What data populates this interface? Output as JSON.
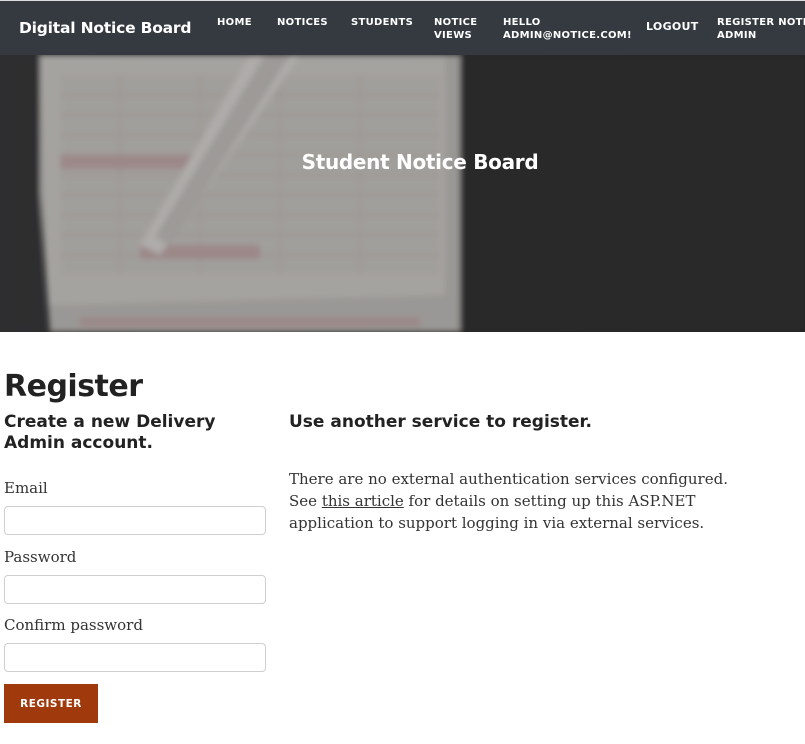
{
  "nav": {
    "brand": "Digital Notice Board",
    "links": [
      {
        "lines": [
          "HOME"
        ]
      },
      {
        "lines": [
          "NOTICES"
        ]
      },
      {
        "lines": [
          "STUDENTS"
        ]
      },
      {
        "lines": [
          "NOTICE",
          "VIEWS"
        ]
      },
      {
        "lines": [
          "HELLO",
          "ADMIN@NOTICE.COM!"
        ]
      },
      {
        "lines": [
          "LOGOUT"
        ]
      },
      {
        "lines": [
          "REGISTER NOTICE",
          "ADMIN"
        ]
      }
    ]
  },
  "hero": {
    "title": "Student Notice Board"
  },
  "page": {
    "title": "Register",
    "left_heading": "Create a new Delivery Admin account.",
    "right_heading": "Use another service to register."
  },
  "form": {
    "email_label": "Email",
    "email_value": "",
    "password_label": "Password",
    "password_value": "",
    "confirm_label": "Confirm password",
    "confirm_value": "",
    "submit_label": "Register"
  },
  "external": {
    "text_before": "There are no external authentication services configured. See ",
    "link_text": "this article",
    "text_after": " for details on setting up this ASP.NET application to support logging in via external services."
  },
  "colors": {
    "navbar": "#343a40",
    "button": "#a0390c"
  }
}
